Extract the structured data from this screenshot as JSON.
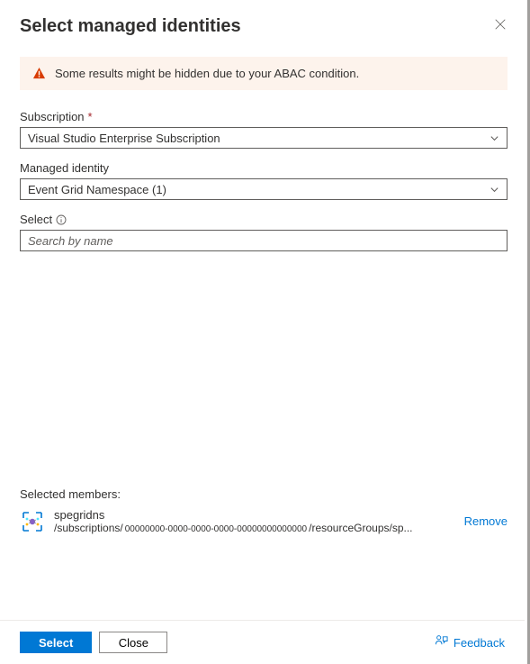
{
  "header": {
    "title": "Select managed identities"
  },
  "alert": {
    "message": "Some results might be hidden due to your ABAC condition."
  },
  "fields": {
    "subscription": {
      "label": "Subscription",
      "value": "Visual Studio Enterprise Subscription"
    },
    "managed_identity": {
      "label": "Managed identity",
      "value": "Event Grid Namespace (1)"
    },
    "select": {
      "label": "Select",
      "placeholder": "Search by name"
    }
  },
  "selected": {
    "label": "Selected members:",
    "members": [
      {
        "name": "spegridns",
        "path_prefix": "/subscriptions/",
        "path_guid": "00000000-0000-0000-0000-00000000000000",
        "path_suffix": "/resourceGroups/sp..."
      }
    ],
    "remove_label": "Remove"
  },
  "footer": {
    "select_label": "Select",
    "close_label": "Close",
    "feedback_label": "Feedback"
  }
}
